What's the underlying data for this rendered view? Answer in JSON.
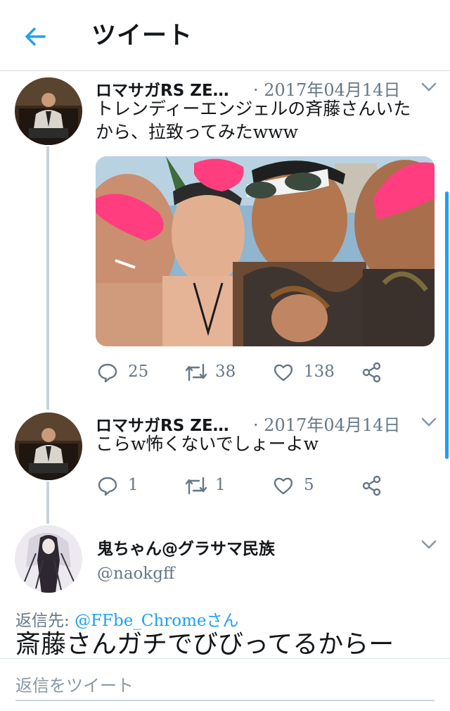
{
  "header": {
    "title": "ツイート",
    "back_icon": "arrow-left-icon",
    "accent": "#1da1f2"
  },
  "tweets": [
    {
      "name": "ロマサガRS ZE…",
      "date": "· 2017年04月14日",
      "text_lines": [
        "トレンディーエンジェルの斉藤さんいた",
        "から、拉致ってみたwww"
      ],
      "has_photo": true,
      "actions": {
        "replies": "25",
        "retweets": "38",
        "likes": "138"
      }
    },
    {
      "name": "ロマサガRS ZE…",
      "date": "· 2017年04月14日",
      "text_lines": [
        "こらw怖くないでしょーよw"
      ],
      "actions": {
        "replies": "1",
        "retweets": "1",
        "likes": "5"
      }
    }
  ],
  "reply": {
    "name": "鬼ちゃん@グラサマ民族",
    "handle": "@naokgff",
    "reply_to_prefix": "返信先: ",
    "reply_to_user": "@FFbe_Chromeさん",
    "text": "斎藤さんガチでびびってるからー"
  },
  "compose": {
    "placeholder": "返信をツイート"
  },
  "colors": {
    "meta": "#657786",
    "thread": "#c8d3dc",
    "pink": "#ff3d7f"
  }
}
